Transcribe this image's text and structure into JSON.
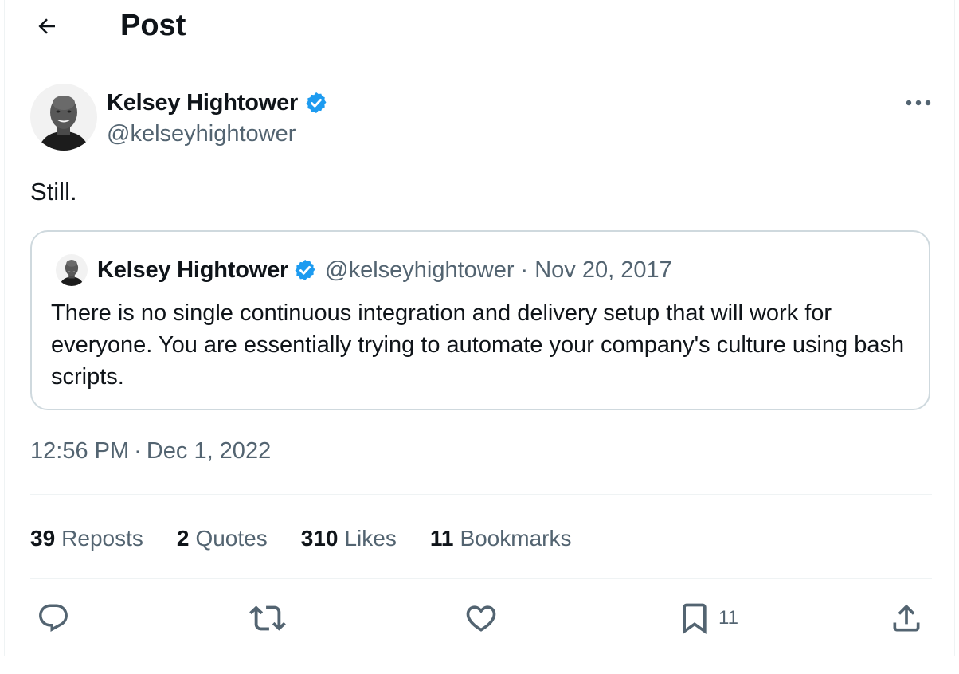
{
  "header": {
    "title": "Post",
    "back_icon": "arrow-left-icon"
  },
  "author": {
    "name": "Kelsey Hightower",
    "handle": "@kelseyhightower",
    "verified": true,
    "verified_color": "#1d9bf0"
  },
  "post": {
    "text": "Still."
  },
  "quote": {
    "name": "Kelsey Hightower",
    "handle": "@kelseyhightower",
    "separator": "·",
    "date": "Nov 20, 2017",
    "text": "There is no single continuous integration and delivery setup that will work for everyone. You are essentially trying to automate your company's culture using bash scripts."
  },
  "timestamp": {
    "time": "12:56 PM",
    "separator": "·",
    "date": "Dec 1, 2022"
  },
  "stats": [
    {
      "count": "39",
      "label": "Reposts"
    },
    {
      "count": "2",
      "label": "Quotes"
    },
    {
      "count": "310",
      "label": "Likes"
    },
    {
      "count": "11",
      "label": "Bookmarks"
    }
  ],
  "actions": {
    "reply_icon": "reply-icon",
    "repost_icon": "repost-icon",
    "like_icon": "heart-icon",
    "bookmark_icon": "bookmark-icon",
    "bookmark_count": "11",
    "share_icon": "share-icon"
  },
  "colors": {
    "text": "#0f1419",
    "secondary": "#536471",
    "border": "#cfd9de",
    "divider": "#eff3f4"
  }
}
